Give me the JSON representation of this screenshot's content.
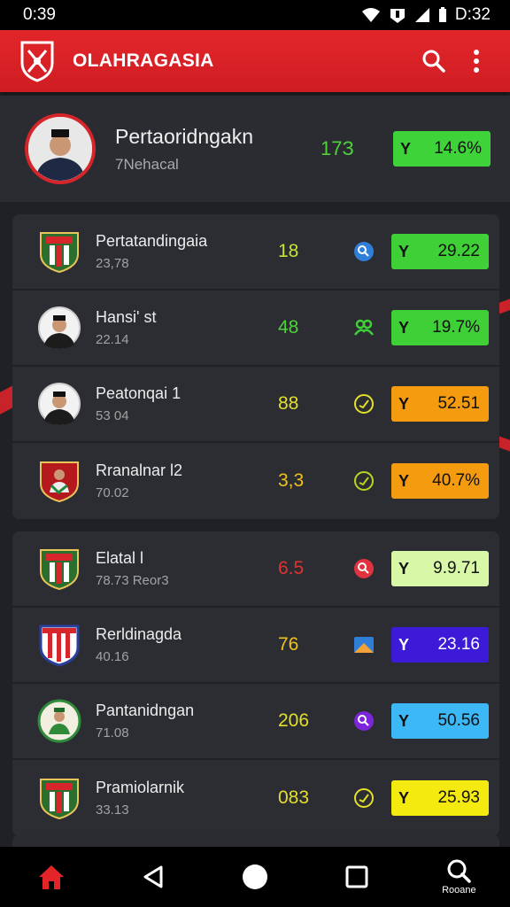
{
  "status": {
    "time_left": "0:39",
    "time_right": "D:32"
  },
  "app": {
    "title": "OLAHRAGASIA",
    "logo_icon": "crossed-swords-shield-icon",
    "search_icon": "search-icon",
    "menu_icon": "more-vert-icon"
  },
  "profile": {
    "name": "Pertaoridngakn",
    "sub": "7Nehacal",
    "score": "17З",
    "pill_value": "14.6%",
    "pill_color": "#3fd33a",
    "score_color": "#4fd23a"
  },
  "group1": [
    {
      "name": "Pertatandingaia",
      "sub": "23,78",
      "score": "18",
      "score_color": "#c6e335",
      "icon": "circle-badge-icon",
      "icon_color": "#2f7ed8",
      "pill": "29.22",
      "pill_color": "#3fcf36",
      "crest": "shield-crest"
    },
    {
      "name": "Hansi' st",
      "sub": "22.14",
      "score": "48",
      "score_color": "#4fd23a",
      "icon": "people-icon",
      "icon_color": "#3fcf36",
      "pill": "19.7%",
      "pill_color": "#3fcf36",
      "crest": "player-portrait"
    },
    {
      "name": "Peatonqai 1",
      "sub": "53 04",
      "score": "88",
      "score_color": "#e4df2a",
      "icon": "check-circle-icon",
      "icon_color": "#e4df2a",
      "pill": "52.51",
      "pill_color": "#f59b10",
      "crest": "player-portrait"
    },
    {
      "name": "Rranalnar l2",
      "sub": "70.02",
      "score": "3,3",
      "score_color": "#f1c21b",
      "icon": "check-circle-icon",
      "icon_color": "#b9d520",
      "pill": "40.7%",
      "pill_color": "#f59b10",
      "crest": "player-shield"
    }
  ],
  "group2": [
    {
      "name": "Elatal l",
      "sub": "78.73 Reor3",
      "score": "6.5",
      "score_color": "#e0332f",
      "icon": "circle-badge-icon",
      "icon_color": "#e0333f",
      "pill": "9.9.71",
      "pill_color": "#d8f8a8",
      "crest": "shield-crest"
    },
    {
      "name": "Rerldinagda",
      "sub": "40.16",
      "score": "76",
      "score_color": "#f1c21b",
      "icon": "flag-badge-icon",
      "icon_color": "#2f7ed8",
      "pill": "23.16",
      "pill_color": "#3c1ad8",
      "crest": "striped-shield"
    },
    {
      "name": "Pantanidngan",
      "sub": "71.08",
      "score": "206",
      "score_color": "#e4df2a",
      "icon": "circle-badge-icon",
      "icon_color": "#7d25d8",
      "pill": "50.56",
      "pill_color": "#3bb8f5",
      "crest": "round-crest"
    },
    {
      "name": "Pramiolarnik",
      "sub": "33.13",
      "score": "083",
      "score_color": "#e4df2a",
      "icon": "check-circle-icon",
      "icon_color": "#e4df2a",
      "pill": "25.93",
      "pill_color": "#f5ea10",
      "crest": "shield-crest"
    }
  ],
  "nav": {
    "home_icon": "home-icon",
    "back_icon": "back-triangle-icon",
    "home_circle_icon": "home-circle-icon",
    "recents_icon": "recents-square-icon",
    "search_icon": "search-icon",
    "search_label": "Rooane"
  },
  "colors": {
    "accent": "#d6262b",
    "background": "#1f2125",
    "card": "#2a2c31"
  }
}
